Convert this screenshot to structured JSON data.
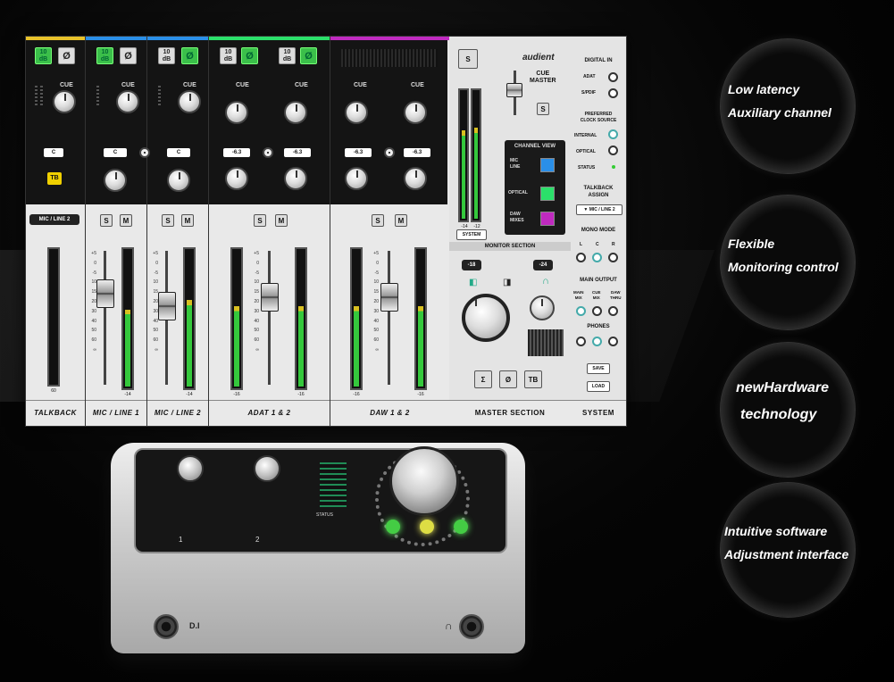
{
  "channels": [
    {
      "name": "TALKBACK",
      "color": "#e8c22a",
      "label": "MIC / LINE 2",
      "tb": "TB",
      "pan": "C"
    },
    {
      "name": "MIC / LINE 1",
      "color": "#2a8fe8",
      "pan": "C",
      "meter": "-14"
    },
    {
      "name": "MIC / LINE 2",
      "color": "#2a8fe8",
      "pan": "C",
      "meter": "-14"
    },
    {
      "name": "ADAT 1 & 2",
      "color": "#2be06a",
      "pan": "-6.3",
      "meter": "-16"
    },
    {
      "name": "DAW 1 & 2",
      "color": "#c02ac0",
      "pan": "-6.3",
      "meter": "-16"
    }
  ],
  "ui": {
    "btn_10": "10\ndB",
    "phi": "Ø",
    "cue": "CUE",
    "s": "S",
    "m": "M",
    "talkback_value": "60"
  },
  "master": {
    "brand": "audient",
    "cue_master": "CUE\nMASTER",
    "s": "S",
    "channel_view": "CHANNEL VIEW",
    "cv_items": [
      "MIC\nLINE",
      "OPTICAL",
      "DAW\nMIXES"
    ],
    "system_btn": "SYSTEM",
    "monitor_section": "MONITOR SECTION",
    "level_left": "-18",
    "level_right": "-24",
    "meter_l": "-14",
    "meter_r": "-12",
    "buttons": [
      "Σ",
      "Ø",
      "TB"
    ],
    "title": "MASTER SECTION"
  },
  "system": {
    "digital_in": "DIGITAL IN",
    "adat": "ADAT",
    "spdif": "S/PDIF",
    "preferred": "PREFERRED\nCLOCK SOURCE",
    "internal": "INTERNAL",
    "optical": "OPTICAL",
    "status": "STATUS",
    "talkback_assign": "TALKBACK\nASSIGN",
    "tb_select": "▼ MIC / LINE 2",
    "mono_mode": "MONO MODE",
    "lcr": [
      "L",
      "C",
      "R"
    ],
    "main_output": "MAIN OUTPUT",
    "outs": [
      "MAIN\nMIX",
      "CUE\nMIX",
      "DAW\nTHRU"
    ],
    "phones": "PHONES",
    "save": "SAVE",
    "load": "LOAD",
    "title": "SYSTEM"
  },
  "hardware": {
    "ch1": "1",
    "ch2": "2",
    "di": "D.I",
    "status": "STATUS"
  },
  "features": [
    {
      "l1": "Low latency",
      "l2": "Auxiliary channel"
    },
    {
      "l1": "Flexible",
      "l2": "Monitoring control"
    },
    {
      "l1": "newHardware",
      "l2": "technology"
    },
    {
      "l1": "Intuitive software",
      "l2": "Adjustment interface"
    }
  ]
}
